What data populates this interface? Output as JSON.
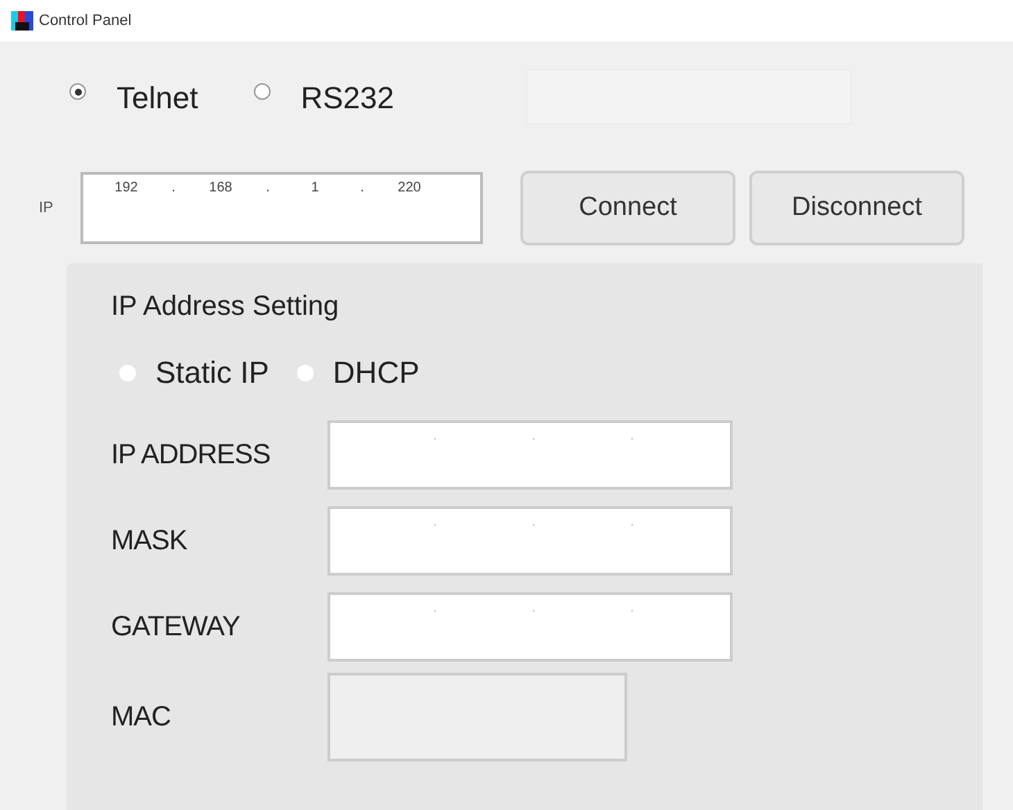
{
  "window": {
    "title": "Control Panel"
  },
  "connection_type": [
    {
      "label": "Telnet",
      "selected": true
    },
    {
      "label": "RS232",
      "selected": false
    }
  ],
  "ip": {
    "label": "IP",
    "parts": [
      "192",
      ".",
      "168",
      ".",
      "1",
      ".",
      "220"
    ]
  },
  "buttons": [
    "Connect",
    "Disconnect"
  ],
  "ip_address_setting": {
    "title": "IP Address Setting",
    "modes": [
      {
        "label": "Static IP",
        "selected": false
      },
      {
        "label": "DHCP",
        "selected": false
      }
    ],
    "fields": [
      {
        "label": "IP ADDRESS",
        "kind": "ip",
        "separators": [
          ".",
          ".",
          "."
        ]
      },
      {
        "label": "MASK",
        "kind": "ip",
        "separators": [
          ".",
          ".",
          "."
        ]
      },
      {
        "label": "GATEWAY",
        "kind": "ip",
        "separators": [
          ".",
          ".",
          "."
        ]
      },
      {
        "label": "MAC",
        "kind": "readonly"
      }
    ]
  }
}
